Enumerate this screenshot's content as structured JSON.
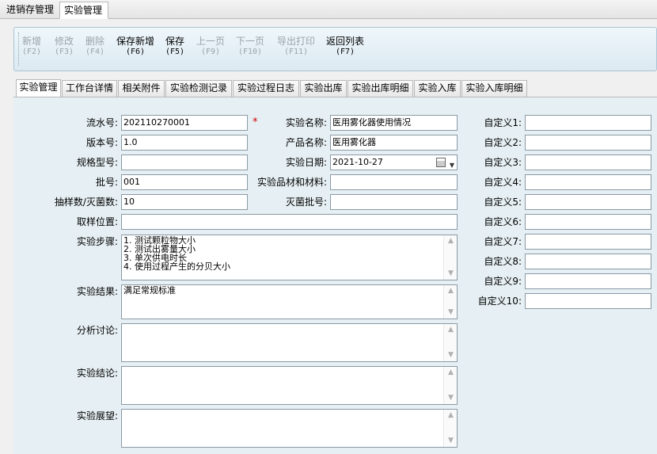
{
  "top_tabs": [
    "进销存管理",
    "实验管理"
  ],
  "toolbar": [
    {
      "label": "新增",
      "key": "(F2)",
      "enabled": false
    },
    {
      "label": "修改",
      "key": "(F3)",
      "enabled": false
    },
    {
      "label": "删除",
      "key": "(F4)",
      "enabled": false
    },
    {
      "label": "保存新增",
      "key": "(F6)",
      "enabled": true
    },
    {
      "label": "保存",
      "key": "(F5)",
      "enabled": true
    },
    {
      "label": "上一页",
      "key": "(F9)",
      "enabled": false
    },
    {
      "label": "下一页",
      "key": "(F10)",
      "enabled": false
    },
    {
      "label": "导出打印",
      "key": "(F11)",
      "enabled": false
    },
    {
      "label": "返回列表",
      "key": "(F7)",
      "enabled": true
    }
  ],
  "inner_tabs": [
    "实验管理",
    "工作台详情",
    "相关附件",
    "实验检测记录",
    "实验过程日志",
    "实验出库",
    "实验出库明细",
    "实验入库",
    "实验入库明细"
  ],
  "form": {
    "serial_label": "流水号:",
    "serial_value": "202110270001",
    "required_mark": "*",
    "version_label": "版本号:",
    "version_value": "1.0",
    "spec_label": "规格型号:",
    "spec_value": "",
    "batch_label": "批号:",
    "batch_value": "001",
    "sample_label": "抽样数/灭菌数:",
    "sample_value": "10",
    "location_label": "取样位置:",
    "location_value": "",
    "exp_name_label": "实验名称:",
    "exp_name_value": "医用雾化器使用情况",
    "product_label": "产品名称:",
    "product_value": "医用雾化器",
    "date_label": "实验日期:",
    "date_value": "2021-10-27",
    "materials_label": "实验品材和材料:",
    "materials_value": "",
    "steril_label": "灭菌批号:",
    "steril_value": "",
    "steps_label": "实验步骤:",
    "steps_value": "1. 测试颗粒物大小\n2. 测试出雾量大小\n3. 单次供电时长\n4. 使用过程产生的分贝大小",
    "result_label": "实验结果:",
    "result_value": "满足常规标准",
    "analysis_label": "分析讨论:",
    "analysis_value": "",
    "conclusion_label": "实验结论:",
    "conclusion_value": "",
    "outlook_label": "实验展望:",
    "outlook_value": ""
  },
  "custom": [
    "自定义1:",
    "自定义2:",
    "自定义3:",
    "自定义4:",
    "自定义5:",
    "自定义6:",
    "自定义7:",
    "自定义8:",
    "自定义9:",
    "自定义10:"
  ]
}
